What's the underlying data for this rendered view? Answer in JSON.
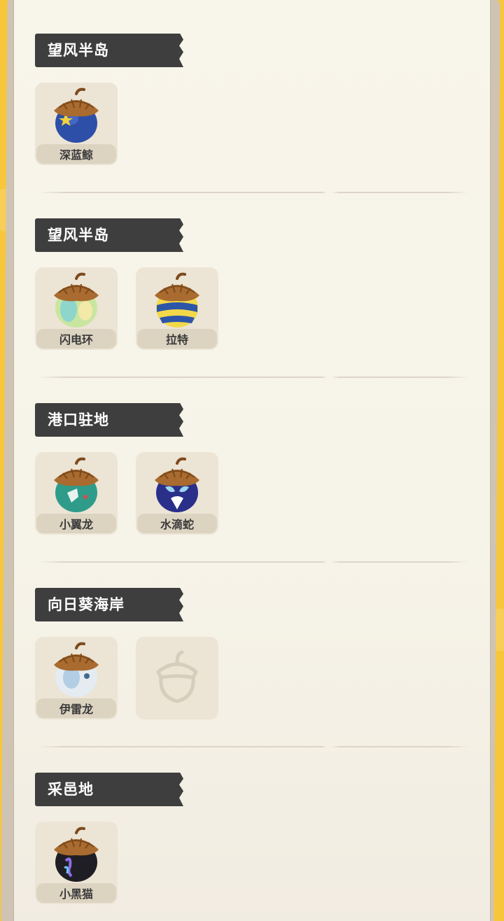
{
  "sections": [
    {
      "region": "望风半岛",
      "pets": [
        {
          "name": "深蓝鲸",
          "icon": "acorn-blue-star-icon",
          "color": "#2e4fa8",
          "accent": "#f2d33b"
        }
      ]
    },
    {
      "region": "望风半岛",
      "pets": [
        {
          "name": "闪电环",
          "icon": "acorn-pastel-icon",
          "color": "#c9e6a0",
          "accent": "#7fd1d6"
        },
        {
          "name": "拉特",
          "icon": "acorn-blue-yellow-icon",
          "color": "#2d56a8",
          "accent": "#f3d94a"
        }
      ]
    },
    {
      "region": "港口驻地",
      "pets": [
        {
          "name": "小翼龙",
          "icon": "acorn-teal-icon",
          "color": "#2f9c8a",
          "accent": "#e8f3ef"
        },
        {
          "name": "水滴蛇",
          "icon": "acorn-navy-icon",
          "color": "#2a2f8a",
          "accent": "#9ad7ef"
        }
      ]
    },
    {
      "region": "向日葵海岸",
      "pets": [
        {
          "name": "伊雷龙",
          "icon": "acorn-white-icon",
          "color": "#e4ecf2",
          "accent": "#a6c6e0"
        },
        {
          "name": "",
          "icon": "acorn-locked-outline-icon",
          "locked": true
        }
      ]
    },
    {
      "region": "采邑地",
      "pets": [
        {
          "name": "小黑猫",
          "icon": "acorn-black-icon",
          "color": "#1e1e24",
          "accent": "#8f6ee6"
        }
      ]
    }
  ]
}
